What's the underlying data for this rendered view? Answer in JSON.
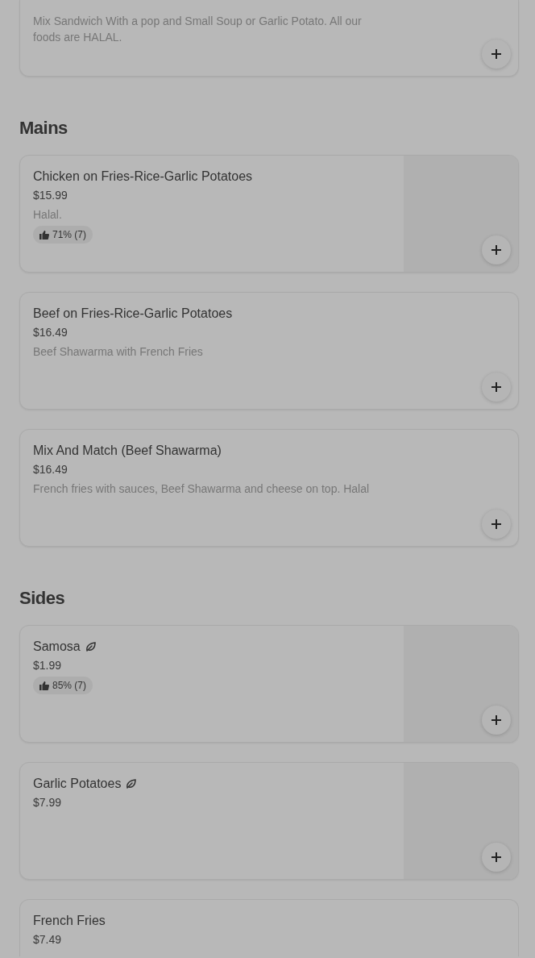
{
  "sections": [
    {
      "items": [
        {
          "description": "Mix Sandwich With a pop and Small Soup or Garlic Potato. All our foods are HALAL.",
          "vegetarian": false,
          "image": false
        }
      ]
    },
    {
      "title": "Mains",
      "items": [
        {
          "name": "Chicken on Fries-Rice-Garlic Potatoes",
          "price": "$15.99",
          "description": "Halal.",
          "rating": "71% (7)",
          "vegetarian": false,
          "image": true
        },
        {
          "name": "Beef on Fries-Rice-Garlic Potatoes",
          "price": "$16.49",
          "description": "Beef Shawarma with French Fries",
          "vegetarian": false,
          "image": false
        },
        {
          "name": "Mix And Match (Beef Shawarma)",
          "price": "$16.49",
          "description": "French fries with sauces, Beef Shawarma and cheese on top. Halal",
          "vegetarian": false,
          "image": false
        }
      ]
    },
    {
      "title": "Sides",
      "items": [
        {
          "name": "Samosa",
          "price": "$1.99",
          "rating": "85% (7)",
          "vegetarian": true,
          "image": true
        },
        {
          "name": "Garlic Potatoes",
          "price": "$7.99",
          "vegetarian": true,
          "image": true
        },
        {
          "name": "French Fries",
          "price": "$7.49",
          "vegetarian": false,
          "image": false
        }
      ]
    }
  ]
}
